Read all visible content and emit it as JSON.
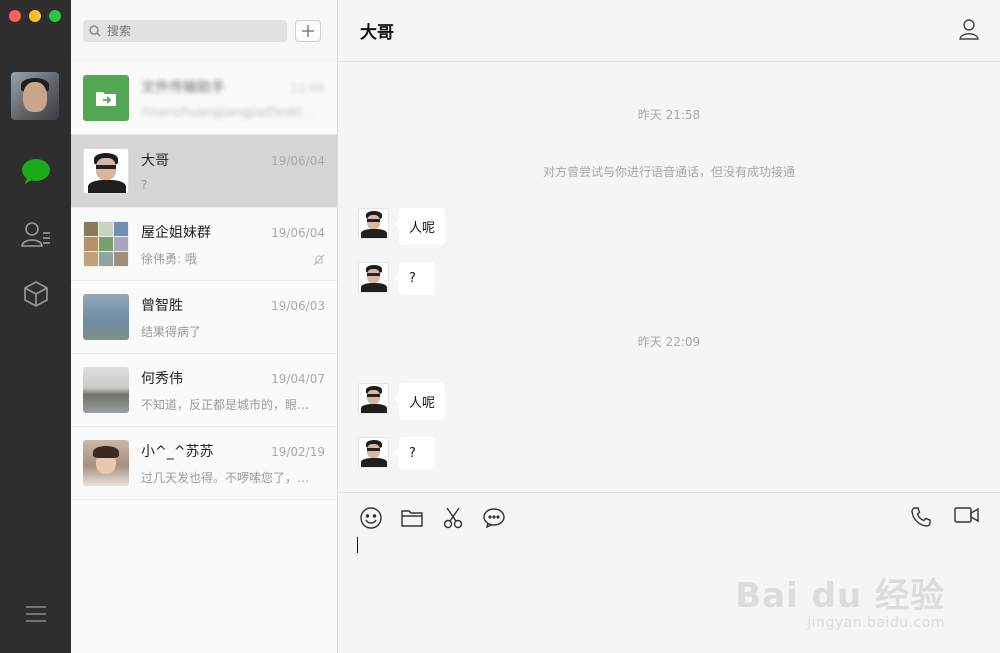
{
  "sidebar": {
    "icons": [
      "chat-icon",
      "contacts-icon",
      "favorites-box-icon",
      "menu-icon"
    ],
    "accent": "#1aad19"
  },
  "search": {
    "placeholder": "搜索"
  },
  "conversations": [
    {
      "name": "文件传输助手",
      "time": "11:46",
      "preview": "/Users/huangjiangjia/Desktop/...",
      "blurred": true
    },
    {
      "name": "大哥",
      "time": "19/06/04",
      "preview": "?",
      "selected": true
    },
    {
      "name": "屋企姐妹群",
      "time": "19/06/04",
      "preview": "徐伟勇: 哦",
      "muted": true
    },
    {
      "name": "曾智胜",
      "time": "19/06/03",
      "preview": "结果得病了"
    },
    {
      "name": "何秀伟",
      "time": "19/04/07",
      "preview": "不知道，反正都是城市的，眼…"
    },
    {
      "name": "小^_^苏苏",
      "time": "19/02/19",
      "preview": "过几天发也得。不啰嗦您了，…"
    }
  ],
  "chat": {
    "title": "大哥",
    "messages": [
      {
        "kind": "time",
        "text": "昨天 21:58"
      },
      {
        "kind": "system",
        "text": "对方曾尝试与你进行语音通话，但没有成功接通"
      },
      {
        "kind": "text",
        "text": "人呢"
      },
      {
        "kind": "text",
        "text": "?"
      },
      {
        "kind": "time",
        "text": "昨天 22:09"
      },
      {
        "kind": "text",
        "text": "人呢"
      },
      {
        "kind": "text",
        "text": "?"
      }
    ]
  },
  "toolbar": {
    "left_icons": [
      "emoji-icon",
      "folder-icon",
      "scissors-icon",
      "chat-bubble-icon"
    ],
    "right_icons": [
      "phone-icon",
      "video-icon"
    ]
  },
  "watermark": {
    "main": "Bai du 经验",
    "sub": "jingyan.baidu.com"
  }
}
